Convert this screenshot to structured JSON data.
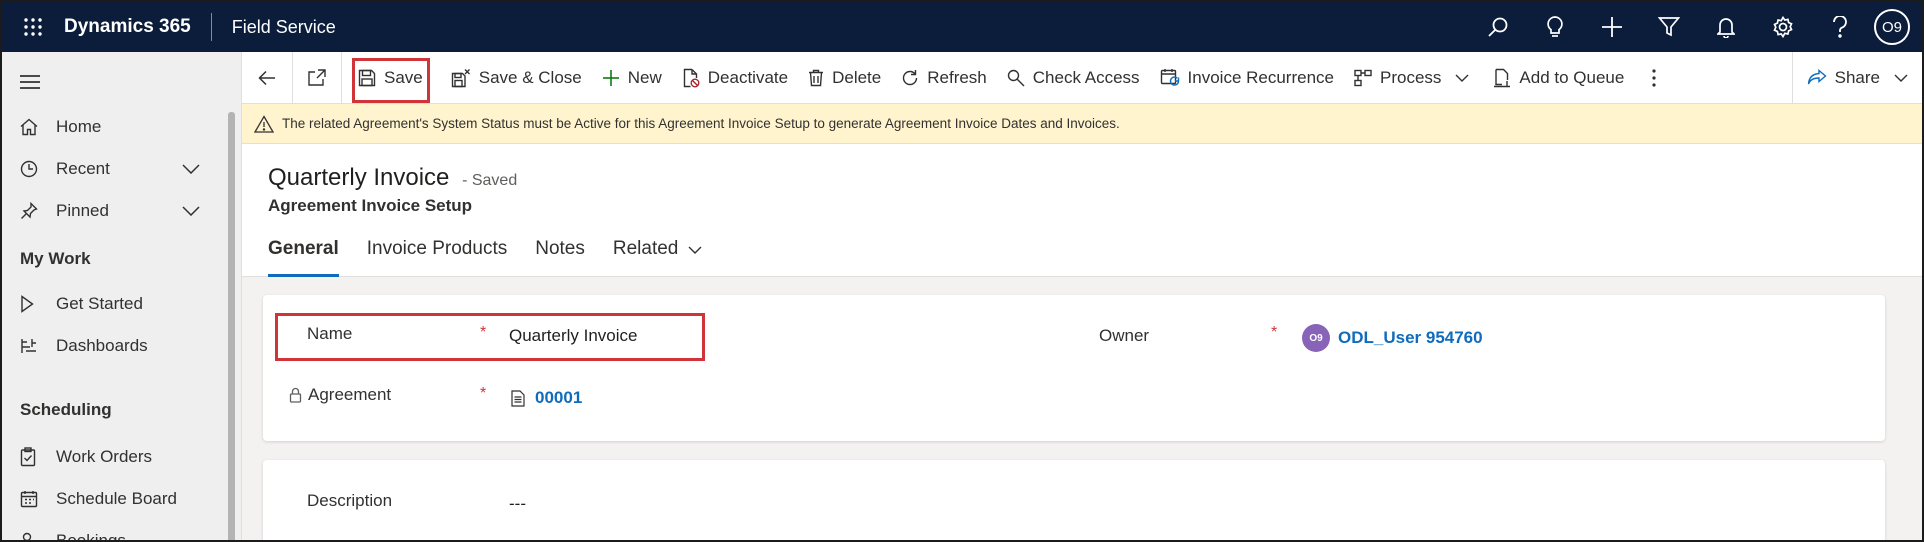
{
  "topbar": {
    "app_title": "Dynamics 365",
    "area_title": "Field Service",
    "user_initials": "O9"
  },
  "sidebar": {
    "items": [
      {
        "label": "Home",
        "icon": "home-icon"
      },
      {
        "label": "Recent",
        "icon": "clock-icon"
      },
      {
        "label": "Pinned",
        "icon": "pin-icon"
      }
    ],
    "my_work_header": "My Work",
    "my_work_items": [
      {
        "label": "Get Started",
        "icon": "play-icon"
      },
      {
        "label": "Dashboards",
        "icon": "dashboard-icon"
      }
    ],
    "scheduling_header": "Scheduling",
    "scheduling_items": [
      {
        "label": "Work Orders",
        "icon": "clipboard-icon"
      },
      {
        "label": "Schedule Board",
        "icon": "calendar-icon"
      },
      {
        "label": "Bookings",
        "icon": "people-icon"
      }
    ]
  },
  "commands": {
    "save": "Save",
    "save_close": "Save & Close",
    "new": "New",
    "deactivate": "Deactivate",
    "delete": "Delete",
    "refresh": "Refresh",
    "check_access": "Check Access",
    "invoice_recurrence": "Invoice Recurrence",
    "process": "Process",
    "add_to_queue": "Add to Queue",
    "share": "Share"
  },
  "warning": {
    "text": "The related Agreement's System Status must be Active for this Agreement Invoice Setup to generate Agreement Invoice Dates and Invoices."
  },
  "record": {
    "title": "Quarterly Invoice",
    "status": "- Saved",
    "entity": "Agreement Invoice Setup"
  },
  "tabs": [
    "General",
    "Invoice Products",
    "Notes",
    "Related"
  ],
  "form": {
    "name_label": "Name",
    "name_value": "Quarterly Invoice",
    "agreement_label": "Agreement",
    "agreement_value": "00001",
    "owner_label": "Owner",
    "owner_initials": "O9",
    "owner_value": "ODL_User 954760",
    "required_marker": "*",
    "description_label": "Description",
    "description_value": "---"
  },
  "colors": {
    "topbar": "#0b1d3a",
    "accent": "#0f6cbd",
    "highlight": "#d13438",
    "warning_bg": "#fff4ce",
    "owner_avatar": "#8764b8"
  }
}
